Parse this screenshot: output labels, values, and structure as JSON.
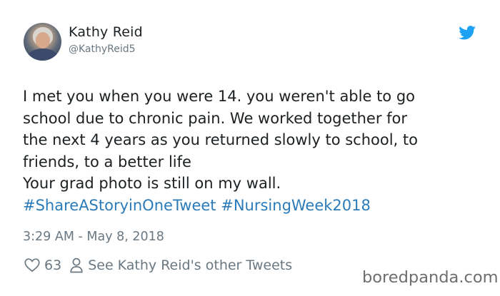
{
  "author": {
    "name": "Kathy Reid",
    "handle": "@KathyReid5"
  },
  "tweet": {
    "lines": [
      "I met you when you were 14. you weren't able to go",
      "school due to chronic pain. We worked together for",
      "the next 4 years as you returned slowly to school, to",
      "friends, to a better life",
      "Your grad photo is still on my wall."
    ],
    "hashtags": [
      "#ShareAStoryinOneTweet",
      "#NursingWeek2018"
    ],
    "timestamp": "3:29 AM - May 8, 2018"
  },
  "actions": {
    "like_count": "63",
    "see_other_label": "See Kathy Reid's other Tweets"
  },
  "watermark": "boredpanda.com",
  "icons": {
    "brand": "twitter-bird-icon",
    "like": "heart-icon",
    "profile": "person-icon"
  },
  "colors": {
    "twitter_blue": "#1da1f2",
    "hashtag": "#2b7bb9",
    "meta_gray": "#697882",
    "text": "#1c2022"
  }
}
